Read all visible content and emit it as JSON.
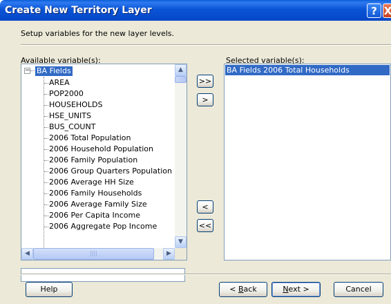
{
  "window": {
    "title": "Create New Territory Layer",
    "help_glyph": "?",
    "close_glyph": "X"
  },
  "instructions": "Setup variables for the new layer levels.",
  "available": {
    "label": "Available variable(s):",
    "root": "BA Fields",
    "expander": "−",
    "items": [
      "AREA",
      "POP2000",
      "HOUSEHOLDS",
      "HSE_UNITS",
      "BUS_COUNT",
      "2006 Total Population",
      "2006 Household Population",
      "2006 Family Population",
      "2006 Group Quarters Population",
      "2006 Average HH Size",
      "2006 Family Households",
      "2006 Average Family Size",
      "2006 Per Capita Income",
      "2006 Aggregate Pop Income"
    ],
    "scroll_up": "▲",
    "scroll_down": "▼",
    "scroll_left": "◀",
    "scroll_right": "▶",
    "thumb_grip": "||||"
  },
  "selected": {
    "label": "Selected variable(s):",
    "items": [
      "BA Fields 2006 Total Households"
    ]
  },
  "move_buttons": {
    "add_all": ">>",
    "add": ">",
    "remove": "<",
    "remove_all": "<<"
  },
  "footer": {
    "help": "Help",
    "back_prefix": "< ",
    "back_hotkey": "B",
    "back_rest": "ack",
    "next_hotkey": "N",
    "next_rest": "ext >",
    "cancel": "Cancel"
  }
}
